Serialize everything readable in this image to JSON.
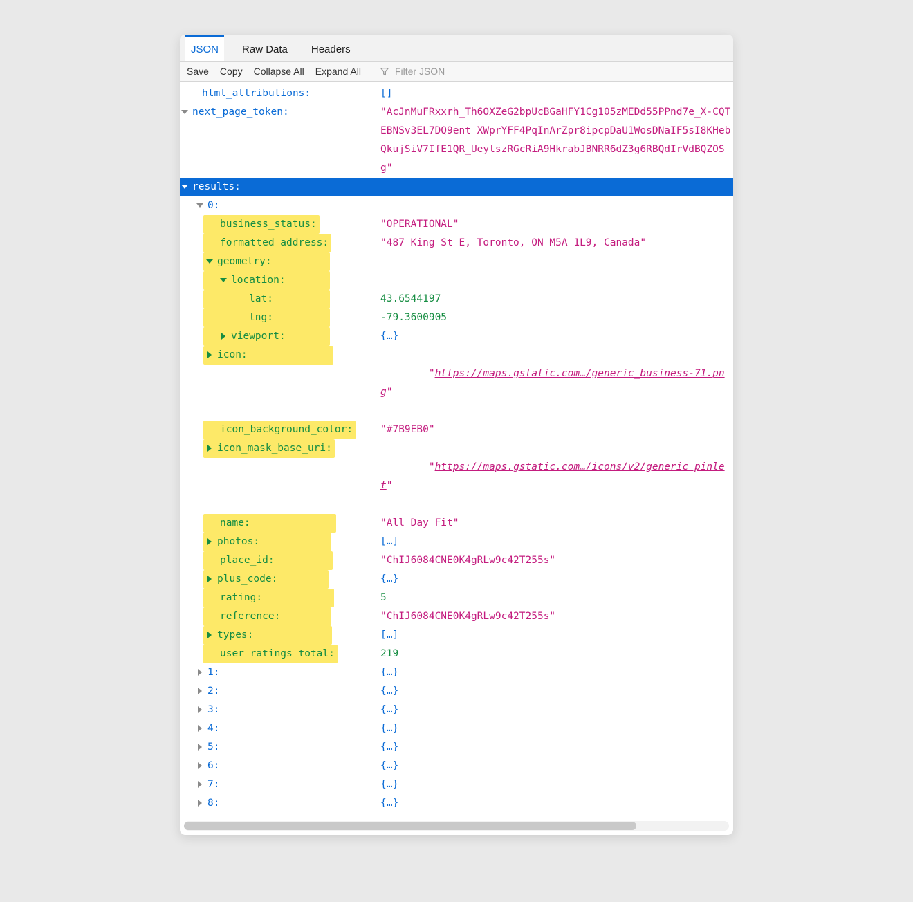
{
  "tabs": {
    "json": "JSON",
    "raw": "Raw Data",
    "headers": "Headers"
  },
  "toolbar": {
    "save": "Save",
    "copy": "Copy",
    "collapse": "Collapse All",
    "expand": "Expand All",
    "filter_placeholder": "Filter JSON"
  },
  "tree": {
    "html_attributions_key": "html_attributions:",
    "html_attributions_val": "[]",
    "next_page_token_key": "next_page_token:",
    "next_page_token_val": "\"AcJnMuFRxxrh_Th6OXZeG2bpUcBGaHFY1Cg105zMEDd55PPnd7e_X-CQTEBNSv3EL7DQ9ent_XWprYFF4PqInArZpr8ipcpDaU1WosDNaIF5sI8KHebQkujSiV7IfE1QR_UeytszRGcRiA9HkrabJBNRR6dZ3g6RBQdIrVdBQZOSg\"",
    "results_key": "results:",
    "idx0_key": "0:",
    "business_status_key": "business_status:",
    "business_status_val": "\"OPERATIONAL\"",
    "formatted_address_key": "formatted_address:",
    "formatted_address_val": "\"487 King St E, Toronto, ON M5A 1L9, Canada\"",
    "geometry_key": "geometry:",
    "location_key": "location:",
    "lat_key": "lat:",
    "lat_val": "43.6544197",
    "lng_key": "lng:",
    "lng_val": "-79.3600905",
    "viewport_key": "viewport:",
    "icon_key": "icon:",
    "icon_val_pre": "\"",
    "icon_val_link": "https://maps.gstatic.com…/generic_business-71.png",
    "icon_val_post": "\"",
    "icon_bg_key": "icon_background_color:",
    "icon_bg_val": "\"#7B9EB0\"",
    "icon_mask_key": "icon_mask_base_uri:",
    "icon_mask_link": "https://maps.gstatic.com…/icons/v2/generic_pinlet",
    "name_key": "name:",
    "name_val": "\"All Day Fit\"",
    "photos_key": "photos:",
    "arr_collapsed": "[…]",
    "obj_collapsed": "{…}",
    "place_id_key": "place_id:",
    "place_id_val": "\"ChIJ6084CNE0K4gRLw9c42T255s\"",
    "plus_code_key": "plus_code:",
    "rating_key": "rating:",
    "rating_val": "5",
    "reference_key": "reference:",
    "reference_val": "\"ChIJ6084CNE0K4gRLw9c42T255s\"",
    "types_key": "types:",
    "user_ratings_key": "user_ratings_total:",
    "user_ratings_val": "219",
    "idx1": "1:",
    "idx2": "2:",
    "idx3": "3:",
    "idx4": "4:",
    "idx5": "5:",
    "idx6": "6:",
    "idx7": "7:",
    "idx8": "8:"
  }
}
